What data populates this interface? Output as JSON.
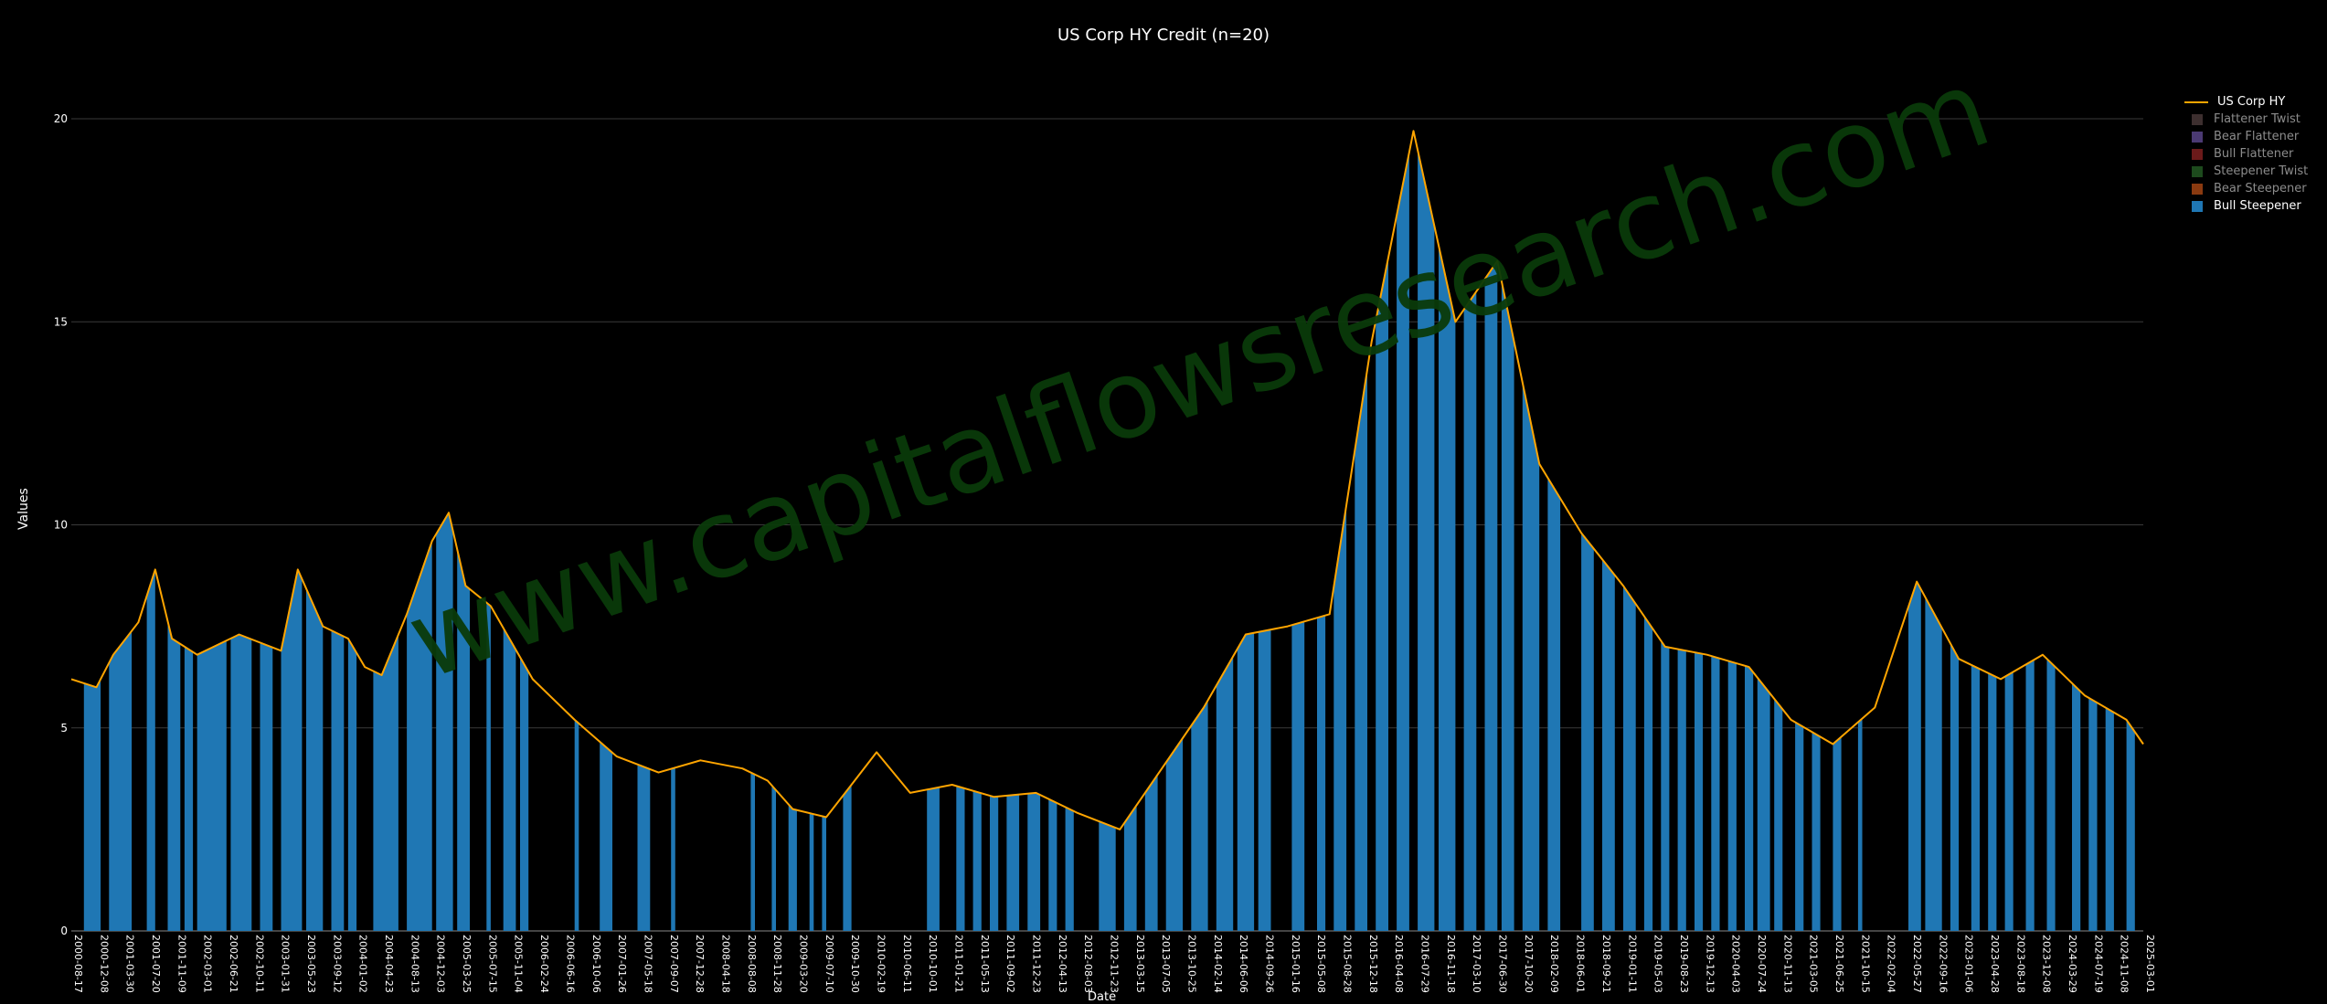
{
  "chart_data": {
    "type": "area",
    "title": "US Corp HY Credit (n=20)",
    "xlabel": "Date",
    "ylabel": "Values",
    "ylim": [
      0,
      21
    ],
    "yticks": [
      0,
      5,
      10,
      15,
      20
    ],
    "grid": true,
    "legend_position": "top-right",
    "watermark": "www.capitalflowsresearch.com",
    "x_tick_labels": [
      "2000-08-17",
      "2000-12-08",
      "2001-03-30",
      "2001-07-20",
      "2001-11-09",
      "2002-03-01",
      "2002-06-21",
      "2002-10-11",
      "2003-01-31",
      "2003-05-23",
      "2003-09-12",
      "2004-01-02",
      "2004-04-23",
      "2004-08-13",
      "2004-12-03",
      "2005-03-25",
      "2005-07-15",
      "2005-11-04",
      "2006-02-24",
      "2006-06-16",
      "2006-10-06",
      "2007-01-26",
      "2007-05-18",
      "2007-09-07",
      "2007-12-28",
      "2008-04-18",
      "2008-08-08",
      "2008-11-28",
      "2009-03-20",
      "2009-07-10",
      "2009-10-30",
      "2010-02-19",
      "2010-06-11",
      "2010-10-01",
      "2011-01-21",
      "2011-05-13",
      "2011-09-02",
      "2011-12-23",
      "2012-04-13",
      "2012-08-03",
      "2012-11-23",
      "2013-03-15",
      "2013-07-05",
      "2013-10-25",
      "2014-02-14",
      "2014-06-06",
      "2014-09-26",
      "2015-01-16",
      "2015-05-08",
      "2015-08-28",
      "2015-12-18",
      "2016-04-08",
      "2016-07-29",
      "2016-11-18",
      "2017-03-10",
      "2017-06-30",
      "2017-10-20",
      "2018-02-09",
      "2018-06-01",
      "2018-09-21",
      "2019-01-11",
      "2019-05-03",
      "2019-08-23",
      "2019-12-13",
      "2020-04-03",
      "2020-07-24",
      "2020-11-13",
      "2021-03-05",
      "2021-06-25",
      "2021-10-15",
      "2022-02-04",
      "2022-05-27",
      "2022-09-16",
      "2023-01-06",
      "2023-04-28",
      "2023-08-18",
      "2023-12-08",
      "2024-03-29",
      "2024-07-19",
      "2024-11-08",
      "2025-03-01"
    ],
    "series": [
      {
        "name": "US Corp HY",
        "kind": "line",
        "color": "#FFA500",
        "x_range": [
          "2000-08-17",
          "2025-03-01"
        ],
        "x": [
          0,
          0.3,
          0.5,
          0.8,
          1.0,
          1.2,
          1.5,
          2.0,
          2.5,
          2.7,
          3.0,
          3.3,
          3.5,
          3.7,
          4.0,
          4.3,
          4.5,
          4.7,
          5.0,
          5.5,
          6.0,
          6.5,
          7.0,
          7.5,
          8.0,
          8.3,
          8.6,
          9.0,
          9.3,
          9.6,
          10.0,
          10.5,
          11.0,
          11.5,
          12.0,
          12.5,
          13.0,
          13.5,
          14.0,
          14.5,
          15.0,
          15.5,
          16.0,
          16.5,
          17.0,
          17.5,
          18.0,
          18.5,
          19.0,
          19.5,
          20.0,
          20.5,
          21.0,
          21.5,
          22.0,
          22.5,
          23.0,
          23.5,
          24.0,
          24.5,
          24.7
        ],
        "values": [
          6.2,
          6.0,
          6.8,
          7.6,
          8.9,
          7.2,
          6.8,
          7.3,
          6.9,
          8.9,
          7.5,
          7.2,
          6.5,
          6.3,
          7.8,
          9.6,
          10.3,
          8.5,
          8.0,
          6.2,
          5.2,
          4.3,
          3.9,
          4.2,
          4.0,
          3.7,
          3.0,
          2.8,
          3.6,
          4.4,
          3.4,
          3.6,
          3.3,
          3.4,
          2.9,
          2.5,
          4.0,
          5.5,
          7.3,
          7.5,
          7.8,
          14.5,
          19.7,
          15.0,
          16.5,
          11.5,
          9.8,
          8.5,
          7.0,
          6.8,
          6.5,
          5.2,
          4.6,
          5.5,
          8.6,
          6.7,
          6.2,
          6.8,
          5.8,
          5.2,
          4.6
        ]
      },
      {
        "name": "Flattener Twist",
        "kind": "bar",
        "color": "#3d2f2f"
      },
      {
        "name": "Bear Flattener",
        "kind": "bar",
        "color": "#4b3a73"
      },
      {
        "name": "Bull Flattener",
        "kind": "bar",
        "color": "#6b1a1a"
      },
      {
        "name": "Steepener Twist",
        "kind": "bar",
        "color": "#1d4a1d"
      },
      {
        "name": "Bear Steepener",
        "kind": "bar",
        "color": "#8a3a10"
      },
      {
        "name": "Bull Steepener",
        "kind": "bar",
        "color": "#1f77b4"
      }
    ],
    "regime_periods": [
      [
        0.15,
        0.35
      ],
      [
        0.45,
        0.72
      ],
      [
        0.9,
        1.0
      ],
      [
        1.15,
        1.3
      ],
      [
        1.35,
        1.45
      ],
      [
        1.5,
        1.85
      ],
      [
        1.9,
        2.15
      ],
      [
        2.25,
        2.4
      ],
      [
        2.5,
        2.75
      ],
      [
        2.8,
        3.0
      ],
      [
        3.1,
        3.25
      ],
      [
        3.3,
        3.4
      ],
      [
        3.6,
        3.9
      ],
      [
        4.0,
        4.3
      ],
      [
        4.35,
        4.55
      ],
      [
        4.6,
        4.75
      ],
      [
        4.95,
        5.0
      ],
      [
        5.15,
        5.3
      ],
      [
        5.35,
        5.45
      ],
      [
        6.0,
        6.05
      ],
      [
        6.3,
        6.45
      ],
      [
        6.75,
        6.9
      ],
      [
        7.15,
        7.2
      ],
      [
        8.1,
        8.15
      ],
      [
        8.35,
        8.4
      ],
      [
        8.55,
        8.65
      ],
      [
        8.8,
        8.85
      ],
      [
        8.95,
        9.0
      ],
      [
        9.2,
        9.3
      ],
      [
        10.2,
        10.35
      ],
      [
        10.55,
        10.65
      ],
      [
        10.75,
        10.85
      ],
      [
        10.95,
        11.05
      ],
      [
        11.15,
        11.3
      ],
      [
        11.4,
        11.55
      ],
      [
        11.65,
        11.75
      ],
      [
        11.85,
        11.95
      ],
      [
        12.25,
        12.45
      ],
      [
        12.55,
        12.7
      ],
      [
        12.8,
        12.95
      ],
      [
        13.05,
        13.25
      ],
      [
        13.35,
        13.55
      ],
      [
        13.65,
        13.85
      ],
      [
        13.9,
        14.1
      ],
      [
        14.15,
        14.3
      ],
      [
        14.55,
        14.7
      ],
      [
        14.85,
        14.95
      ],
      [
        15.05,
        15.2
      ],
      [
        15.3,
        15.45
      ],
      [
        15.55,
        15.7
      ],
      [
        15.8,
        15.95
      ],
      [
        16.05,
        16.25
      ],
      [
        16.3,
        16.5
      ],
      [
        16.6,
        16.75
      ],
      [
        16.85,
        17.0
      ],
      [
        17.05,
        17.2
      ],
      [
        17.3,
        17.5
      ],
      [
        17.6,
        17.75
      ],
      [
        18.0,
        18.15
      ],
      [
        18.25,
        18.4
      ],
      [
        18.5,
        18.65
      ],
      [
        18.75,
        18.85
      ],
      [
        18.95,
        19.05
      ],
      [
        19.15,
        19.25
      ],
      [
        19.35,
        19.45
      ],
      [
        19.55,
        19.65
      ],
      [
        19.75,
        19.85
      ],
      [
        19.95,
        20.05
      ],
      [
        20.1,
        20.25
      ],
      [
        20.3,
        20.4
      ],
      [
        20.55,
        20.65
      ],
      [
        20.75,
        20.85
      ],
      [
        21.0,
        21.1
      ],
      [
        21.3,
        21.35
      ],
      [
        21.9,
        22.05
      ],
      [
        22.1,
        22.3
      ],
      [
        22.4,
        22.5
      ],
      [
        22.65,
        22.75
      ],
      [
        22.85,
        22.95
      ],
      [
        23.05,
        23.15
      ],
      [
        23.3,
        23.4
      ],
      [
        23.55,
        23.65
      ],
      [
        23.85,
        23.95
      ],
      [
        24.05,
        24.15
      ],
      [
        24.25,
        24.35
      ],
      [
        24.5,
        24.6
      ]
    ]
  }
}
